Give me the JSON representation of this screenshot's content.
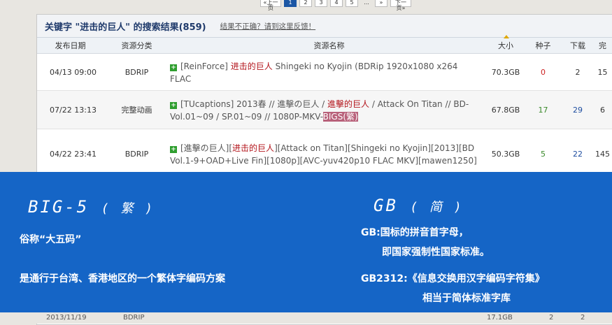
{
  "pager": {
    "prev": "«上一页",
    "pages": [
      "1",
      "2",
      "3",
      "4",
      "5"
    ],
    "ellipsis": "...",
    "next_a": "»",
    "next_b": "下一页»"
  },
  "header": {
    "title": "关键字 \"进击的巨人\" 的搜索结果(859)",
    "feedback": "结果不正确？请到这里反馈！"
  },
  "columns": {
    "date": "发布日期",
    "category": "资源分类",
    "name": "资源名称",
    "size": "大小",
    "seeds": "种子",
    "downloads": "下载",
    "done": "完"
  },
  "rows": [
    {
      "date": "04/13 09:00",
      "category": "BDRIP",
      "name_pre": "[ReinForce] ",
      "name_hl": "进击的巨人",
      "name_post": " Shingeki no Kyojin (BDRip 1920x1080 x264 FLAC",
      "size": "70.3GB",
      "seeds": "0",
      "downloads": "2",
      "done": "15"
    },
    {
      "date": "07/22 13:13",
      "category": "完整动画",
      "name_pre": "[TUcaptions] 2013春 // 進擊の巨人 / ",
      "name_hl": "進擊的巨人",
      "name_mid": " / Attack On Titan // BD-Vol.01~09 / SP.01~09 // 1080P-MKV-",
      "name_mark": "BIGS(繁)",
      "size": "67.8GB",
      "seeds": "17",
      "downloads": "29",
      "done": "6"
    },
    {
      "date": "04/22 23:41",
      "category": "BDRIP",
      "name_pre": "[進擊の巨人][",
      "name_hl": "进击的巨人",
      "name_post": "][Attack on Titan][Shingeki no Kyojin][2013][BD Vol.1-9+OAD+Live Fin][1080p][AVC-yuv420p10 FLAC MKV][mawen1250]",
      "size": "50.3GB",
      "seeds": "5",
      "downloads": "22",
      "done": "145"
    }
  ],
  "bottom_row": {
    "date": "2013/11/19",
    "category": "BDRIP",
    "size": "17.1GB",
    "seeds": "2",
    "downloads": "2"
  },
  "overlay": {
    "big5_title": "BIG-5",
    "big5_paren": "( 繁 )",
    "big5_line1": "俗称“大五码”",
    "big5_line2": "是通行于台湾、香港地区的一个繁体字编码方案",
    "gb_title": "GB",
    "gb_paren": "( 简 )",
    "gb_line1": "GB:国标的拼音首字母，",
    "gb_line2": "即国家强制性国家标准。",
    "gb_line3": "GB2312:《信息交换用汉字编码字符集》",
    "gb_line4": "相当于简体标准字库"
  },
  "colors": {
    "overlay": "#1565c6",
    "highlight": "#b3141b",
    "green_icon": "#2f9e2f"
  }
}
